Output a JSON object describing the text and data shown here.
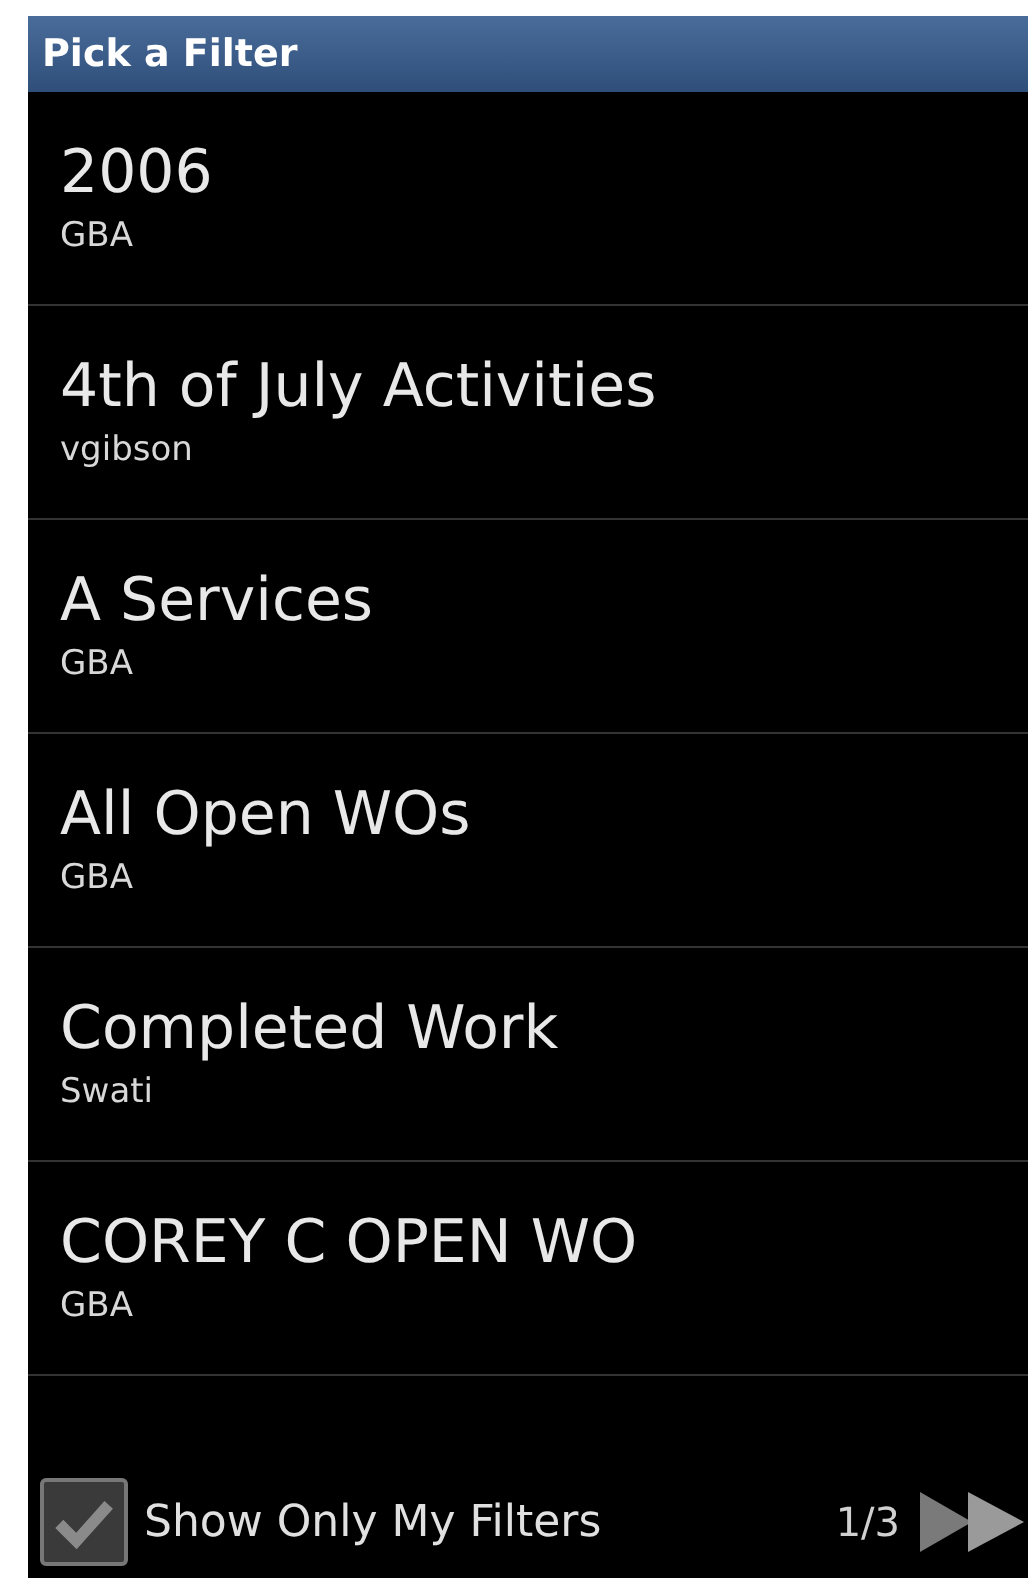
{
  "window": {
    "title": "Pick a Filter"
  },
  "filters": [
    {
      "name": "2006",
      "owner": "GBA"
    },
    {
      "name": "4th of July Activities",
      "owner": "vgibson"
    },
    {
      "name": "A Services",
      "owner": "GBA"
    },
    {
      "name": "All Open WOs",
      "owner": "GBA"
    },
    {
      "name": "Completed Work",
      "owner": "Swati"
    },
    {
      "name": "COREY C OPEN WO",
      "owner": "GBA"
    }
  ],
  "footer": {
    "show_only_mine": {
      "label": "Show Only My Filters",
      "checked": true
    },
    "page": "1/3"
  }
}
